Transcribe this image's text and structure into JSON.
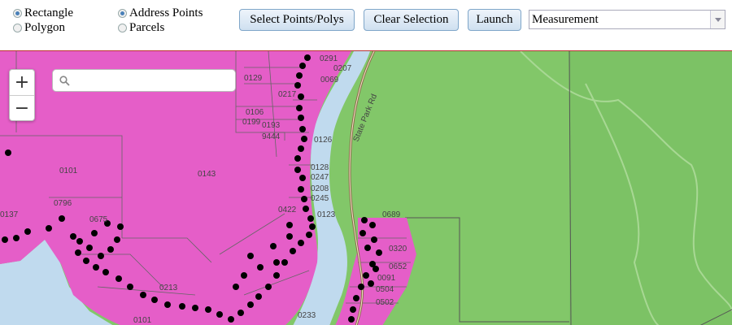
{
  "selection_mode": {
    "options": [
      {
        "label": "Rectangle",
        "checked": true
      },
      {
        "label": "Polygon",
        "checked": false
      }
    ]
  },
  "layer": {
    "options": [
      {
        "label": "Address Points",
        "checked": true
      },
      {
        "label": "Parcels",
        "checked": false
      }
    ]
  },
  "toolbar": {
    "select_label": "Select Points/Polys",
    "clear_label": "Clear Selection",
    "launch_label": "Launch"
  },
  "tool_select": {
    "value": "Measurement"
  },
  "map": {
    "search_placeholder": "",
    "zoom_in": "+",
    "zoom_out": "−",
    "road_label": "State Park Rd",
    "parcel_labels": [
      "0129",
      "0291",
      "0207",
      "0069",
      "0217",
      "0106",
      "0199",
      "0193",
      "9444",
      "0126",
      "0101",
      "0143",
      "0128",
      "0247",
      "0208",
      "0245",
      "0123",
      "0422",
      "0689",
      "0320",
      "0652",
      "0091",
      "0504",
      "0502",
      "0675",
      "0796",
      "0137",
      "0213",
      "0233",
      "0101"
    ],
    "colors": {
      "zone_pink": "#e55ec8",
      "zone_green": "#82c769",
      "water": "#c0daee",
      "forest": "#7cc265"
    }
  }
}
